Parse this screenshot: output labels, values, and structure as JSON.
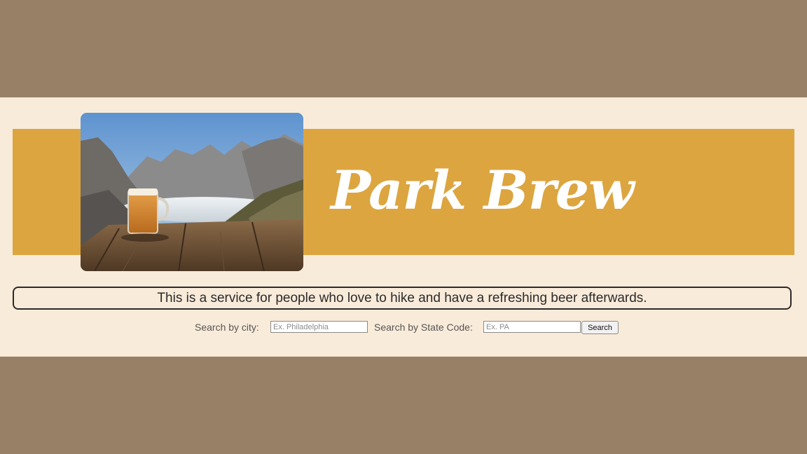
{
  "header": {
    "title": "Park Brew",
    "photo_icon": "mountain-beer-photo"
  },
  "tagline": "This is a service for people who love to hike and have a refreshing beer afterwards.",
  "search": {
    "city_label": "Search by city:",
    "city_placeholder": "Ex. Philadelphia",
    "state_label": "Search by State Code:",
    "state_placeholder": "Ex. PA",
    "button_label": "Search"
  },
  "colors": {
    "background": "#988067",
    "band": "#f9ebd9",
    "header_bar": "#dca53f",
    "title": "#ffffff"
  }
}
